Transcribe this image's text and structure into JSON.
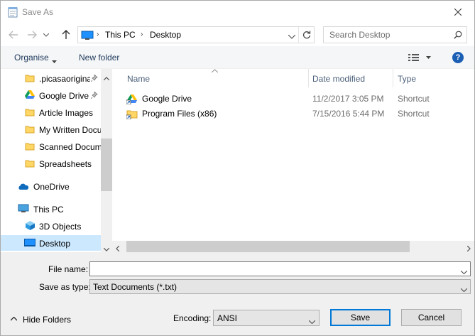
{
  "window": {
    "title": "Save As"
  },
  "address": {
    "crumbs": [
      "This PC",
      "Desktop"
    ],
    "separator": "›"
  },
  "search": {
    "placeholder": "Search Desktop"
  },
  "toolbar": {
    "organise_label": "Organise",
    "new_folder_label": "New folder",
    "help_label": "?"
  },
  "nav_pane": {
    "items": [
      {
        "label": ".picasaoriginals",
        "icon": "folder-icon",
        "pinned": true
      },
      {
        "label": "Google Drive",
        "icon": "google-drive-icon",
        "pinned": true
      },
      {
        "label": "Article Images",
        "icon": "folder-icon",
        "pinned": false
      },
      {
        "label": "My Written Documents",
        "icon": "folder-icon",
        "pinned": false
      },
      {
        "label": "Scanned Documents",
        "icon": "folder-icon",
        "pinned": false
      },
      {
        "label": "Spreadsheets",
        "icon": "folder-icon",
        "pinned": false
      },
      {
        "label": "OneDrive",
        "icon": "onedrive-icon",
        "pinned": false
      },
      {
        "label": "This PC",
        "icon": "pc-icon",
        "pinned": false
      },
      {
        "label": "3D Objects",
        "icon": "cube-icon",
        "pinned": false
      },
      {
        "label": "Desktop",
        "icon": "desktop-icon",
        "pinned": false,
        "selected": true
      }
    ]
  },
  "file_list": {
    "columns": [
      "Name",
      "Date modified",
      "Type"
    ],
    "rows": [
      {
        "name": "Google Drive",
        "date": "11/2/2017 3:05 PM",
        "type": "Shortcut",
        "icon": "google-drive-shortcut-icon"
      },
      {
        "name": "Program Files (x86)",
        "date": "7/15/2016 5:44 PM",
        "type": "Shortcut",
        "icon": "folder-shortcut-icon"
      }
    ]
  },
  "form": {
    "file_name_label": "File name:",
    "file_name_value": "",
    "save_type_label": "Save as type:",
    "save_type_value": "Text Documents (*.txt)",
    "encoding_label": "Encoding:",
    "encoding_value": "ANSI"
  },
  "footer": {
    "hide_folders_label": "Hide Folders",
    "save_label": "Save",
    "cancel_label": "Cancel"
  },
  "colors": {
    "accent": "#0078d7",
    "selected_bg": "#cce8ff",
    "header_text": "#4c607a",
    "folder": "#ffd766"
  }
}
